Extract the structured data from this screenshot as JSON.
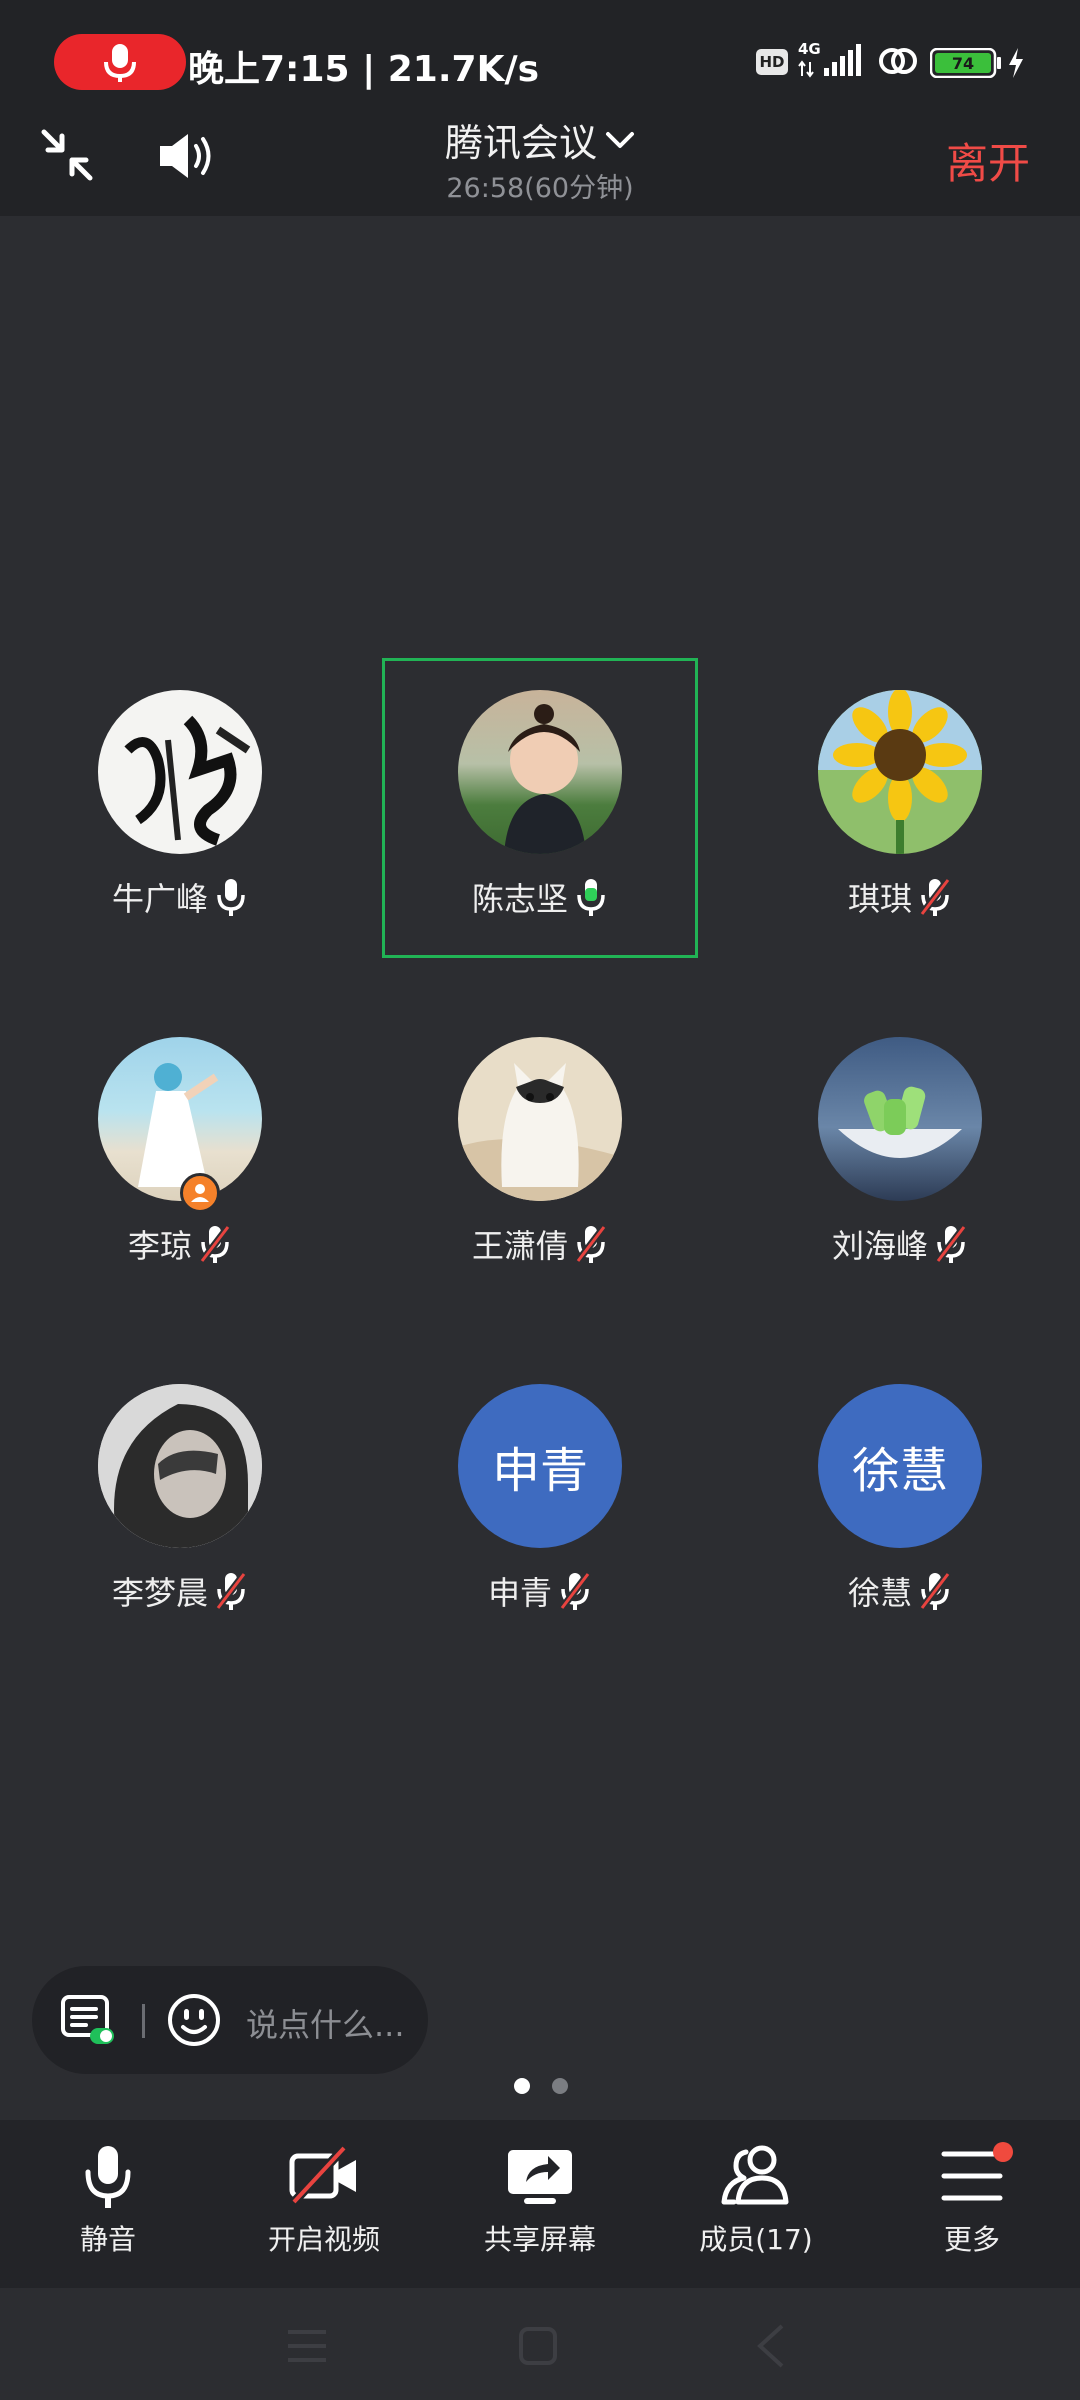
{
  "status_bar": {
    "time_speed": "晚上7:15 | 21.7K/s",
    "hd": "HD",
    "network": "4G",
    "battery": "74",
    "recording_color": "#e9262b"
  },
  "header": {
    "title": "腾讯会议",
    "timer": "26:58(60分钟)",
    "leave": "离开"
  },
  "participants": [
    {
      "name": "牛广峰",
      "mic": "on",
      "avatar": "calligraphy"
    },
    {
      "name": "陈志坚",
      "mic": "speaking",
      "avatar": "child-photo",
      "active": true
    },
    {
      "name": "琪琪",
      "mic": "muted",
      "avatar": "sunflower"
    },
    {
      "name": "李琼",
      "mic": "muted",
      "avatar": "beach-photo",
      "host": true
    },
    {
      "name": "王潇倩",
      "mic": "muted",
      "avatar": "cat-photo"
    },
    {
      "name": "刘海峰",
      "mic": "muted",
      "avatar": "popsicle-photo"
    },
    {
      "name": "李梦晨",
      "mic": "muted",
      "avatar": "bw-portrait"
    },
    {
      "name": "申青",
      "mic": "muted",
      "avatar_text": "申青"
    },
    {
      "name": "徐慧",
      "mic": "muted",
      "avatar_text": "徐慧"
    }
  ],
  "chat": {
    "placeholder": "说点什么..."
  },
  "pager": {
    "pages": 2,
    "current": 1
  },
  "toolbar": {
    "mute": "静音",
    "video": "开启视频",
    "share": "共享屏幕",
    "members": "成员(17)",
    "more": "更多"
  },
  "colors": {
    "background": "#2c2d31",
    "active_speaker": "#21b355",
    "leave": "#f04b47",
    "text_avatar": "#3e6bc0"
  }
}
